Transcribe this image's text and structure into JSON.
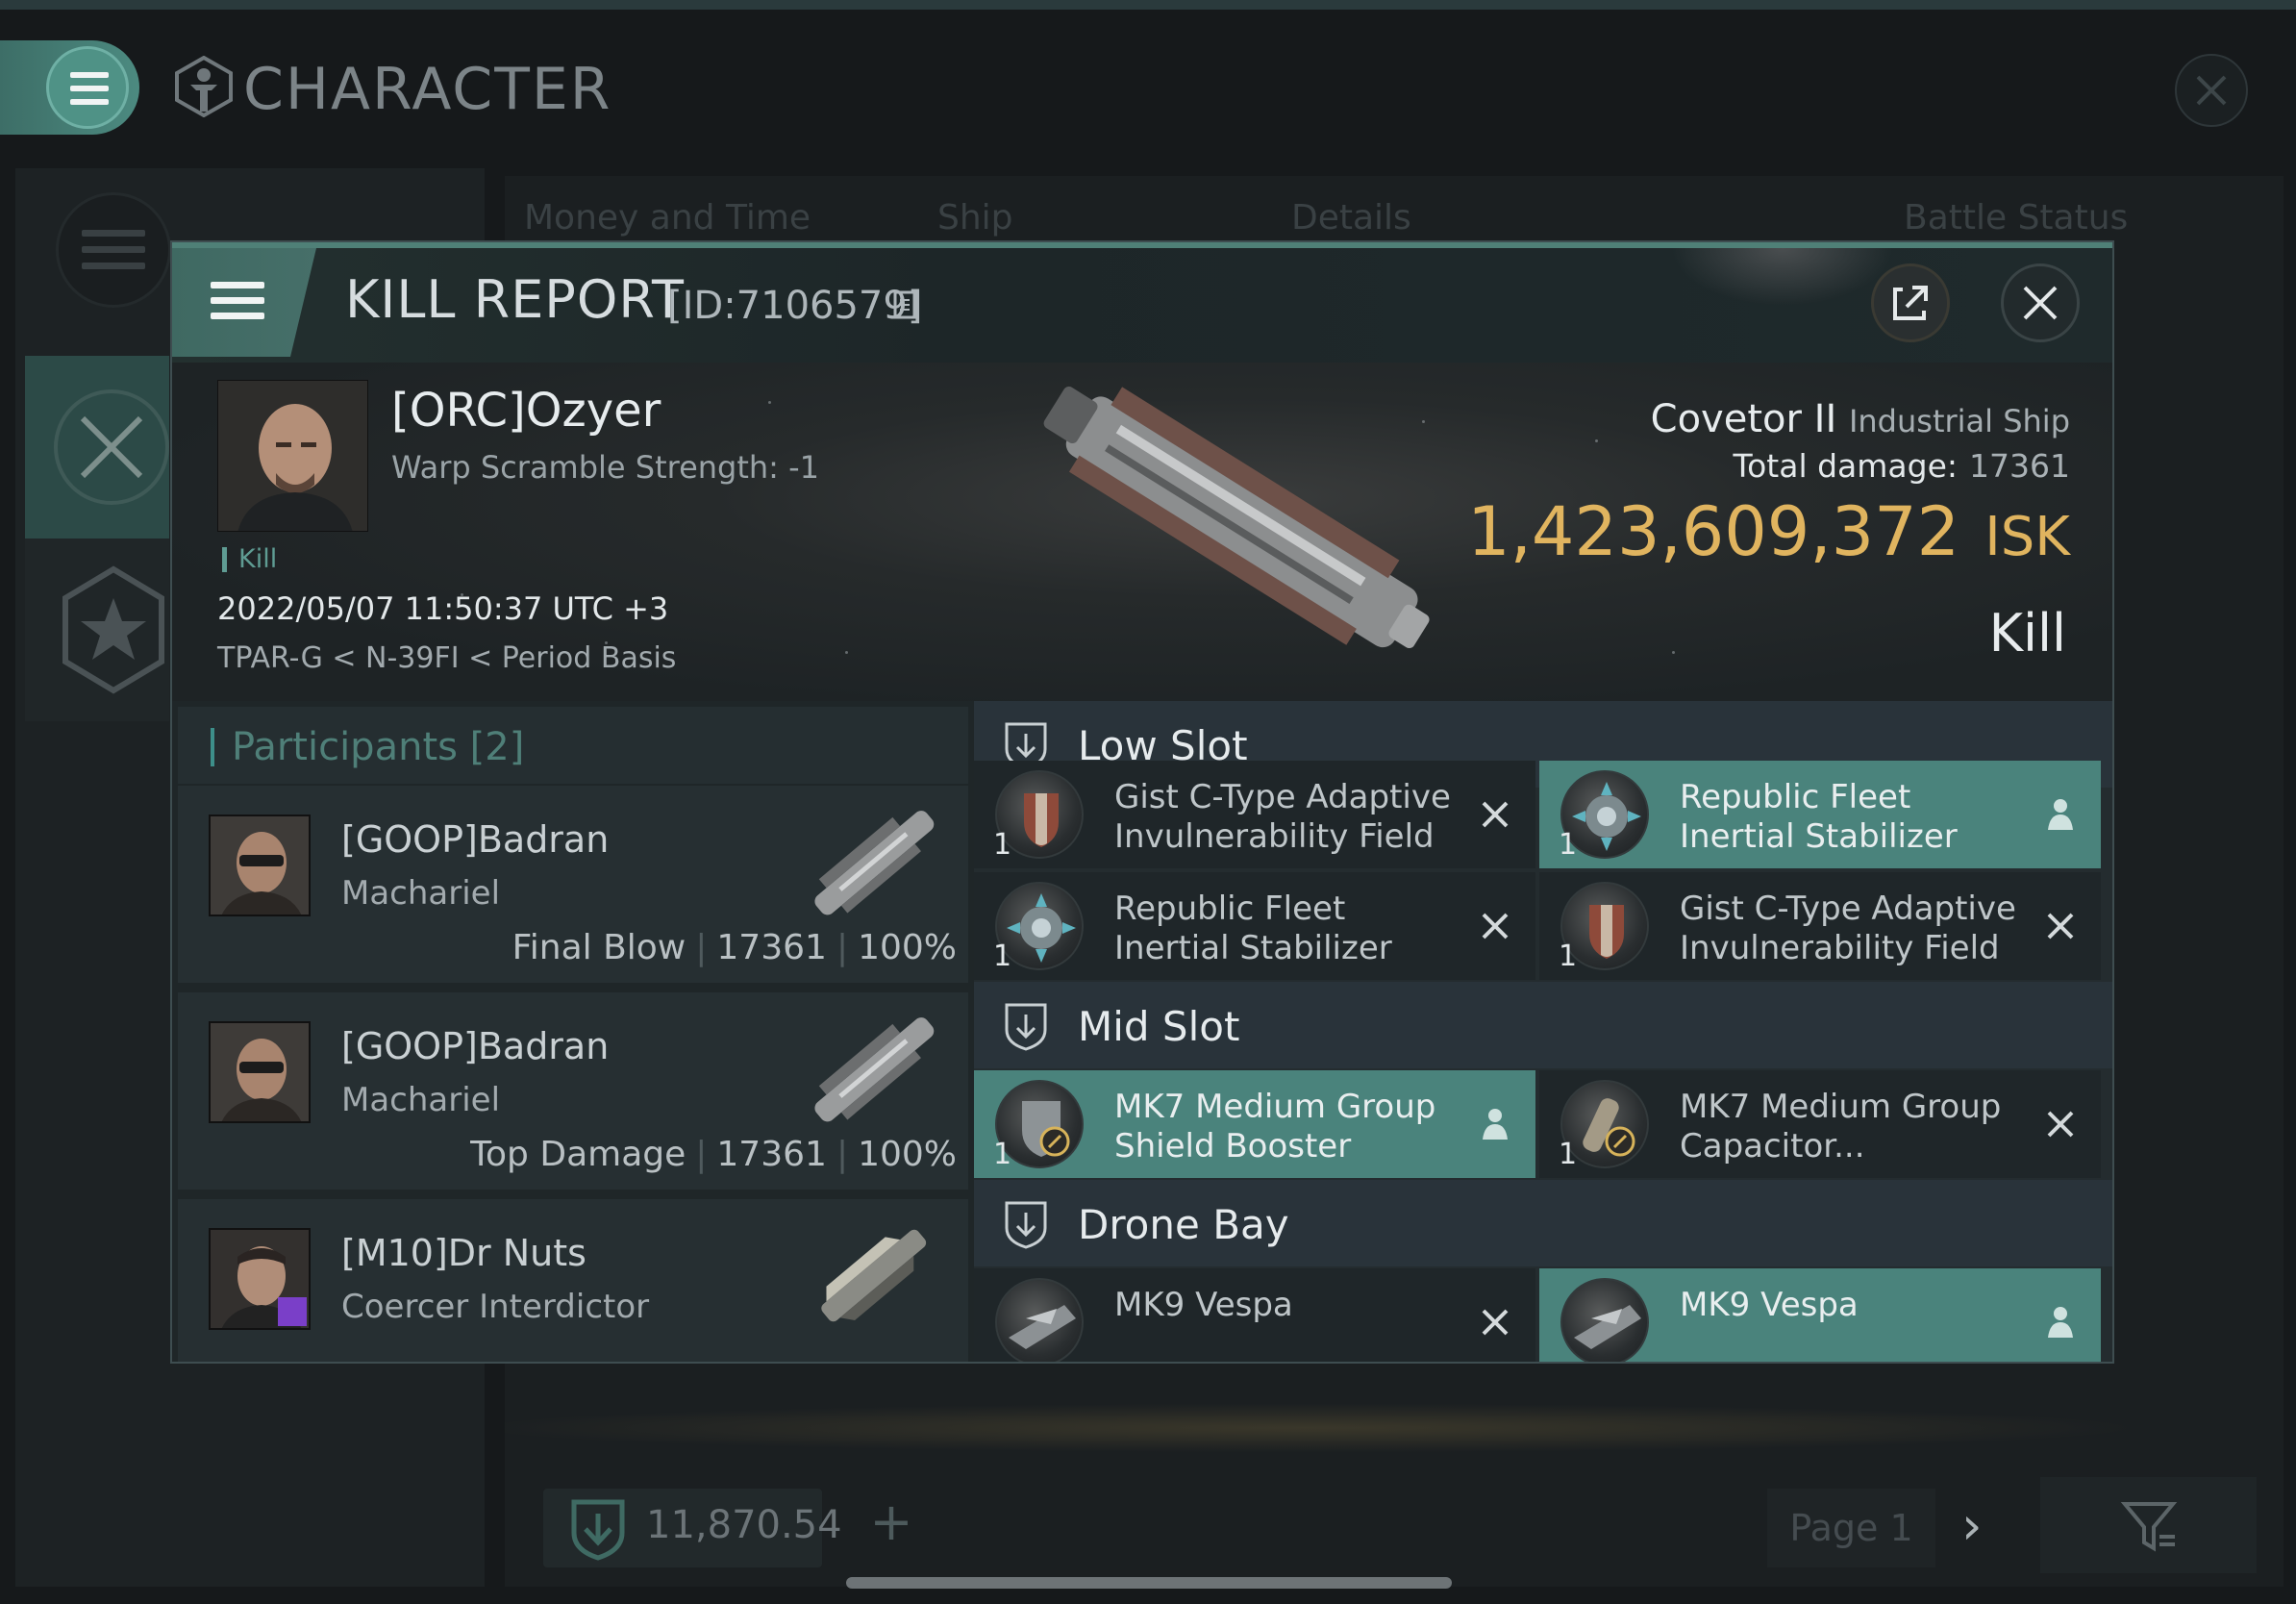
{
  "background": {
    "title": "CHARACTER",
    "columns": [
      "Money and Time",
      "Ship",
      "Details",
      "Battle Status"
    ],
    "footer": {
      "value": "11,870.54",
      "page": "Page 1"
    }
  },
  "modal": {
    "title": "KILL REPORT",
    "id": "[ID:7106579]",
    "victim": {
      "name": "[ORC]Ozyer",
      "warp_scramble": "Warp Scramble Strength: -1",
      "tag": "Kill",
      "datetime": "2022/05/07 11:50:37 UTC +3",
      "location": "TPAR-G < N-39FI < Period Basis",
      "ship": "Covetor II",
      "ship_class": "Industrial Ship",
      "total_damage_label": "Total damage:",
      "total_damage": "17361",
      "isk": "1,423,609,372",
      "isk_unit": "ISK",
      "result": "Kill"
    },
    "participants": {
      "title": "Participants [2]",
      "rows": [
        {
          "name": "[GOOP]Badran",
          "ship": "Machariel",
          "role": "Final Blow",
          "damage": "17361",
          "percent": "100%"
        },
        {
          "name": "[GOOP]Badran",
          "ship": "Machariel",
          "role": "Top Damage",
          "damage": "17361",
          "percent": "100%"
        },
        {
          "name": "[M10]Dr Nuts",
          "ship": "Coercer Interdictor",
          "role": "",
          "damage": "",
          "percent": ""
        }
      ]
    },
    "fittings": {
      "low_slot": {
        "label": "Low Slot",
        "items": [
          {
            "name": "Gist C-Type Adaptive Invulnerability Field",
            "qty": "1",
            "state": "destroyed"
          },
          {
            "name": "Republic Fleet Inertial Stabilizer",
            "qty": "1",
            "state": "dropped"
          },
          {
            "name": "Republic Fleet Inertial Stabilizer",
            "qty": "1",
            "state": "destroyed"
          },
          {
            "name": "Gist C-Type Adaptive Invulnerability Field",
            "qty": "1",
            "state": "destroyed"
          }
        ]
      },
      "mid_slot": {
        "label": "Mid Slot",
        "items": [
          {
            "name": "MK7 Medium Group Shield Booster",
            "qty": "1",
            "state": "dropped"
          },
          {
            "name": "MK7 Medium Group Capacitor...",
            "qty": "1",
            "state": "destroyed"
          }
        ]
      },
      "drone_bay": {
        "label": "Drone Bay",
        "items": [
          {
            "name": "MK9 Vespa",
            "qty": "",
            "state": "destroyed"
          },
          {
            "name": "MK9 Vespa",
            "qty": "",
            "state": "dropped"
          }
        ]
      }
    }
  },
  "colors": {
    "accent": "#4a837c",
    "isk": "#e0b45f",
    "header_bar": "#4f8077"
  },
  "icons": [
    "menu-icon",
    "character-icon",
    "close-icon",
    "copy-icon",
    "share-icon",
    "swords-icon",
    "star-icon",
    "shield-slot-icon",
    "pilot-icon",
    "filter-icon",
    "plus-icon",
    "chevron-right-icon"
  ]
}
